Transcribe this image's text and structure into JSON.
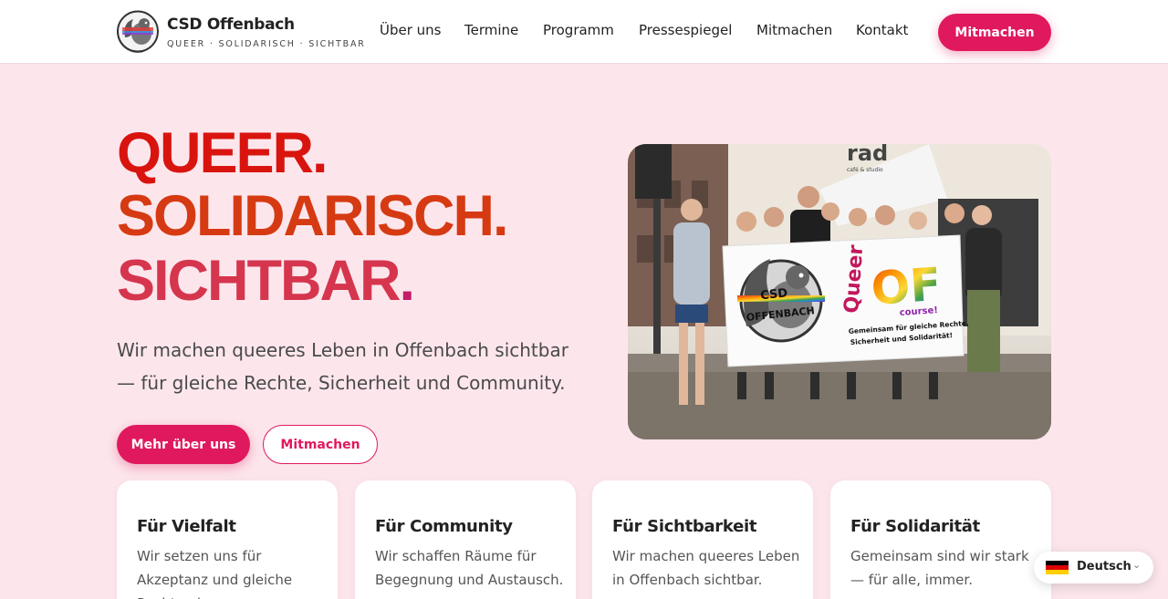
{
  "header": {
    "brand_name": "CSD Offenbach",
    "brand_tagline": "QUEER · SOLIDARISCH · SICHTBAR",
    "logo_icon": "squirrel-logo-icon",
    "nav": [
      {
        "label": "Über uns"
      },
      {
        "label": "Termine"
      },
      {
        "label": "Programm"
      },
      {
        "label": "Pressespiegel"
      },
      {
        "label": "Mitmachen"
      },
      {
        "label": "Kontakt"
      }
    ],
    "cta_label": "Mitmachen"
  },
  "hero": {
    "line1": "QUEER.",
    "line2": "SOLIDARISCH.",
    "line3_word": "SICHTBAR",
    "line3_dot": ".",
    "intro": "Wir machen queeres Leben in Offenbach sichtbar — für gleiche Rechte, Sicherheit und Community.",
    "primary_button": "Mehr über uns",
    "secondary_button": "Mitmachen",
    "photo": {
      "banner_left_line1": "CSD",
      "banner_left_line2": "OFFENBACH",
      "banner_right_word": "Queer",
      "banner_right_big": "OF",
      "banner_right_small": "course!",
      "banner_slogan_line1": "Gemeinsam für gleiche Rechte,",
      "banner_slogan_line2": "Sicherheit und Solidarität!",
      "shop_sign": "rad",
      "shop_sign_sub": "café & studio"
    }
  },
  "cards": [
    {
      "title": "Für Vielfalt",
      "text": "Wir setzen uns für Akzeptanz und gleiche Rechte ein."
    },
    {
      "title": "Für Community",
      "text": "Wir schaffen Räume für Begegnung und Austausch."
    },
    {
      "title": "Für Sichtbarkeit",
      "text": "Wir machen queeres Leben in Offenbach sichtbar."
    },
    {
      "title": "Für Solidarität",
      "text": "Gemeinsam sind wir stark — für alle, immer."
    }
  ],
  "language": {
    "label": "Deutsch",
    "flag_icon": "german-flag-icon",
    "chevron_icon": "chevron-down-icon",
    "flag_colors": [
      "#000000",
      "#dd0000",
      "#ffce00"
    ]
  },
  "colors": {
    "accent": "#e0195e",
    "background": "#fce6ec"
  }
}
